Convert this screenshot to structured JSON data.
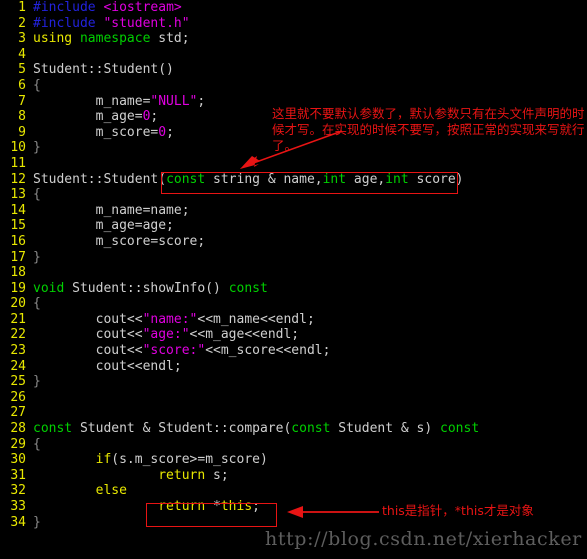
{
  "editor": {
    "background_color": "#000000",
    "gutter_color": "#e8e800",
    "default_text_color": "#cfcfcf",
    "colors": {
      "preprocessor": "#2222dd",
      "string": "#e000e0",
      "keyword": "#e8e800",
      "type": "#00d000",
      "number": "#e000e0",
      "annotation_red": "#e81414",
      "watermark_gray": "#5e5e5e"
    },
    "lines": [
      {
        "n": "1",
        "tokens": [
          {
            "t": "#include ",
            "c": "pre"
          },
          {
            "t": "<iostream>",
            "c": "str"
          }
        ]
      },
      {
        "n": "2",
        "tokens": [
          {
            "t": "#include ",
            "c": "pre"
          },
          {
            "t": "\"student.h\"",
            "c": "str"
          }
        ]
      },
      {
        "n": "3",
        "tokens": [
          {
            "t": "using ",
            "c": "kw"
          },
          {
            "t": "namespace",
            "c": "type"
          },
          {
            "t": " std;",
            "c": "plain"
          }
        ]
      },
      {
        "n": "4",
        "tokens": []
      },
      {
        "n": "5",
        "tokens": [
          {
            "t": "Student::Student()",
            "c": "plain"
          }
        ]
      },
      {
        "n": "6",
        "tokens": [
          {
            "t": "{",
            "c": "brace"
          }
        ]
      },
      {
        "n": "7",
        "tokens": [
          {
            "t": "        m_name=",
            "c": "plain"
          },
          {
            "t": "\"NULL\"",
            "c": "str"
          },
          {
            "t": ";",
            "c": "plain"
          }
        ]
      },
      {
        "n": "8",
        "tokens": [
          {
            "t": "        m_age=",
            "c": "plain"
          },
          {
            "t": "0",
            "c": "num"
          },
          {
            "t": ";",
            "c": "plain"
          }
        ]
      },
      {
        "n": "9",
        "tokens": [
          {
            "t": "        m_score=",
            "c": "plain"
          },
          {
            "t": "0",
            "c": "num"
          },
          {
            "t": ";",
            "c": "plain"
          }
        ]
      },
      {
        "n": "10",
        "tokens": [
          {
            "t": "}",
            "c": "brace"
          }
        ]
      },
      {
        "n": "11",
        "tokens": []
      },
      {
        "n": "12",
        "tokens": [
          {
            "t": "Student::Student(",
            "c": "plain"
          },
          {
            "t": "const",
            "c": "type"
          },
          {
            "t": " string & name,",
            "c": "plain"
          },
          {
            "t": "int",
            "c": "type"
          },
          {
            "t": " age,",
            "c": "plain"
          },
          {
            "t": "int",
            "c": "type"
          },
          {
            "t": " score)",
            "c": "plain"
          }
        ]
      },
      {
        "n": "13",
        "tokens": [
          {
            "t": "{",
            "c": "brace"
          }
        ]
      },
      {
        "n": "14",
        "tokens": [
          {
            "t": "        m_name=name;",
            "c": "plain"
          }
        ]
      },
      {
        "n": "15",
        "tokens": [
          {
            "t": "        m_age=age;",
            "c": "plain"
          }
        ]
      },
      {
        "n": "16",
        "tokens": [
          {
            "t": "        m_score=score;",
            "c": "plain"
          }
        ]
      },
      {
        "n": "17",
        "tokens": [
          {
            "t": "}",
            "c": "brace"
          }
        ]
      },
      {
        "n": "18",
        "tokens": []
      },
      {
        "n": "19",
        "tokens": [
          {
            "t": "void",
            "c": "type"
          },
          {
            "t": " Student::showInfo() ",
            "c": "plain"
          },
          {
            "t": "const",
            "c": "type"
          }
        ]
      },
      {
        "n": "20",
        "tokens": [
          {
            "t": "{",
            "c": "brace"
          }
        ]
      },
      {
        "n": "21",
        "tokens": [
          {
            "t": "        cout<<",
            "c": "plain"
          },
          {
            "t": "\"name:\"",
            "c": "str"
          },
          {
            "t": "<<m_name<<endl;",
            "c": "plain"
          }
        ]
      },
      {
        "n": "22",
        "tokens": [
          {
            "t": "        cout<<",
            "c": "plain"
          },
          {
            "t": "\"age:\"",
            "c": "str"
          },
          {
            "t": "<<m_age<<endl;",
            "c": "plain"
          }
        ]
      },
      {
        "n": "23",
        "tokens": [
          {
            "t": "        cout<<",
            "c": "plain"
          },
          {
            "t": "\"score:\"",
            "c": "str"
          },
          {
            "t": "<<m_score<<endl;",
            "c": "plain"
          }
        ]
      },
      {
        "n": "24",
        "tokens": [
          {
            "t": "        cout<<endl;",
            "c": "plain"
          }
        ]
      },
      {
        "n": "25",
        "tokens": [
          {
            "t": "}",
            "c": "brace"
          }
        ]
      },
      {
        "n": "26",
        "tokens": []
      },
      {
        "n": "27",
        "tokens": []
      },
      {
        "n": "28",
        "tokens": [
          {
            "t": "const",
            "c": "type"
          },
          {
            "t": " Student & Student::compare(",
            "c": "plain"
          },
          {
            "t": "const",
            "c": "type"
          },
          {
            "t": " Student & s) ",
            "c": "plain"
          },
          {
            "t": "const",
            "c": "type"
          }
        ]
      },
      {
        "n": "29",
        "tokens": [
          {
            "t": "{",
            "c": "brace"
          }
        ]
      },
      {
        "n": "30",
        "tokens": [
          {
            "t": "        ",
            "c": "plain"
          },
          {
            "t": "if",
            "c": "kw"
          },
          {
            "t": "(s.m_score>=m_score)",
            "c": "plain"
          }
        ]
      },
      {
        "n": "31",
        "tokens": [
          {
            "t": "                ",
            "c": "plain"
          },
          {
            "t": "return",
            "c": "kw"
          },
          {
            "t": " s;",
            "c": "plain"
          }
        ]
      },
      {
        "n": "32",
        "tokens": [
          {
            "t": "        ",
            "c": "plain"
          },
          {
            "t": "else",
            "c": "kw"
          }
        ]
      },
      {
        "n": "33",
        "tokens": [
          {
            "t": "                ",
            "c": "plain"
          },
          {
            "t": "return",
            "c": "kw"
          },
          {
            "t": " *",
            "c": "plain"
          },
          {
            "t": "this",
            "c": "kw"
          },
          {
            "t": ";",
            "c": "plain"
          }
        ]
      },
      {
        "n": "34",
        "tokens": [
          {
            "t": "}",
            "c": "brace"
          }
        ]
      }
    ]
  },
  "annotations": {
    "default_param_note": "这里就不要默认参数了，默认参数只有在头文件声明的时候才写。在实现的时候不要写，按照正常的实现来写就行了。",
    "this_pointer_note": "this是指针，*this才是对象"
  },
  "watermark": {
    "text": "http://blog.csdn.net/xierhacker"
  }
}
